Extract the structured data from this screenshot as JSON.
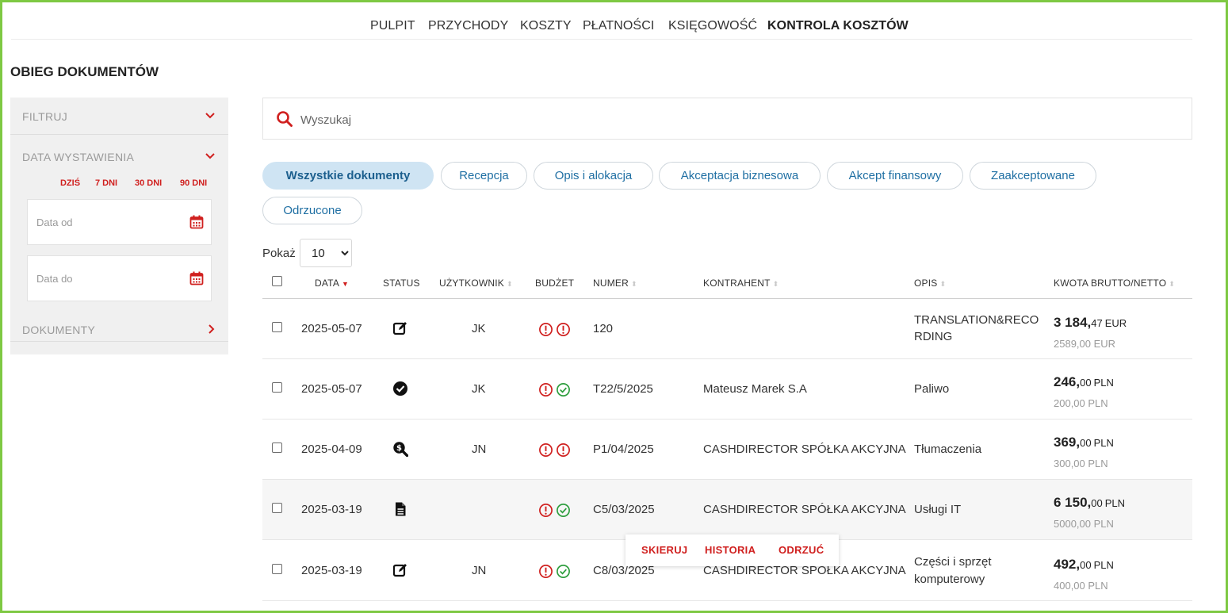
{
  "nav": {
    "items": [
      "PULPIT",
      "PRZYCHODY",
      "KOSZTY",
      "PŁATNOŚCI",
      "KSIĘGOWOŚĆ",
      "KONTROLA KOSZTÓW"
    ],
    "active": "KONTROLA KOSZTÓW"
  },
  "page_title": "OBIEG DOKUMENTÓW",
  "sidebar": {
    "filter_label": "FILTRUJ",
    "date_section_label": "DATA WYSTAWIENIA",
    "quick_ranges": [
      "DZIŚ",
      "7 DNI",
      "30 DNI",
      "90 DNI"
    ],
    "date_from_placeholder": "Data od",
    "date_to_placeholder": "Data do",
    "documents_label": "DOKUMENTY"
  },
  "search": {
    "placeholder": "Wyszukaj",
    "value": ""
  },
  "tabs": [
    "Wszystkie dokumenty",
    "Recepcja",
    "Opis i alokacja",
    "Akceptacja biznesowa",
    "Akcept finansowy",
    "Zaakceptowane",
    "Odrzucone"
  ],
  "active_tab": "Wszystkie dokumenty",
  "page_size": {
    "label": "Pokaż",
    "value": "10"
  },
  "table": {
    "headers": {
      "date": "DATA",
      "status": "STATUS",
      "user": "UŻYTKOWNIK",
      "budget": "BUDŻET",
      "number": "NUMER",
      "contractor": "KONTRAHENT",
      "desc": "OPIS",
      "amount": "KWOTA BRUTTO/NETTO"
    },
    "sorted_by": "DATA",
    "rows": [
      {
        "date": "2025-05-07",
        "status_icon": "edit-icon",
        "user": "JK",
        "budget": [
          "warning",
          "warning"
        ],
        "number": "120",
        "contractor": "",
        "desc": [
          "TRANSLATION&RECO",
          "RDING"
        ],
        "gross_int": "3 184,",
        "gross_frac": "47",
        "gross_cur": "EUR",
        "net": "2589,00 EUR"
      },
      {
        "date": "2025-05-07",
        "status_icon": "approved-icon",
        "user": "JK",
        "budget": [
          "warning",
          "ok"
        ],
        "number": "T22/5/2025",
        "contractor": "Mateusz Marek S.A",
        "desc": [
          "Paliwo"
        ],
        "gross_int": "246,",
        "gross_frac": "00",
        "gross_cur": "PLN",
        "net": "200,00 PLN"
      },
      {
        "date": "2025-04-09",
        "status_icon": "search-dollar-icon",
        "user": "JN",
        "budget": [
          "warning",
          "warning"
        ],
        "number": "P1/04/2025",
        "contractor": "CASHDIRECTOR SPÓŁKA AKCYJNA",
        "desc": [
          "Tłumaczenia"
        ],
        "gross_int": "369,",
        "gross_frac": "00",
        "gross_cur": "PLN",
        "net": "300,00 PLN"
      },
      {
        "date": "2025-03-19",
        "status_icon": "document-icon",
        "user": "",
        "budget": [
          "warning",
          "ok"
        ],
        "number": "C5/03/2025",
        "contractor": "CASHDIRECTOR SPÓŁKA AKCYJNA",
        "desc": [
          "Usługi IT"
        ],
        "gross_int": "6 150,",
        "gross_frac": "00",
        "gross_cur": "PLN",
        "net": "5000,00 PLN"
      },
      {
        "date": "2025-03-19",
        "status_icon": "edit-icon",
        "user": "JN",
        "budget": [
          "warning",
          "ok"
        ],
        "number": "C8/03/2025",
        "contractor": "CASHDIRECTOR SPÓŁKA AKCYJNA",
        "desc": [
          "Części i sprzęt",
          "komputerowy"
        ],
        "gross_int": "492,",
        "gross_frac": "00",
        "gross_cur": "PLN",
        "net": "400,00 PLN"
      }
    ]
  },
  "row_actions": [
    "SKIERUJ",
    "HISTORIA",
    "ODRZUĆ"
  ],
  "colors": {
    "accent_red": "#d0201f",
    "link_blue": "#1f6fa3",
    "active_tab_bg": "#cfe4f3",
    "ok_green": "#2e9e3e",
    "frame_green": "#7ec943"
  }
}
